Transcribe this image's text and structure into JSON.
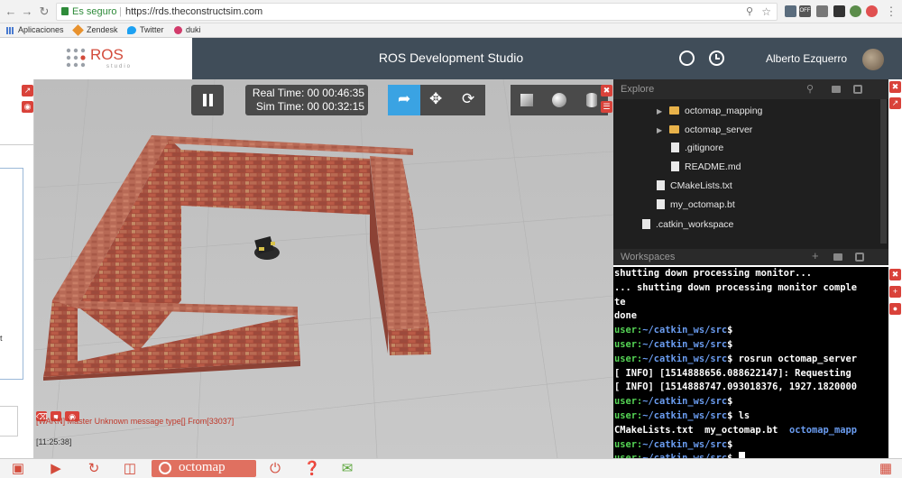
{
  "browser": {
    "secure_label": "Es seguro",
    "url": "https://rds.theconstructsim.com",
    "bookmarks": [
      {
        "label": "Aplicaciones",
        "icon": "apps-grid-icon"
      },
      {
        "label": "Zendesk",
        "icon": "zendesk-icon"
      },
      {
        "label": "Twitter",
        "icon": "twitter-icon"
      },
      {
        "label": "duki",
        "icon": "duki-icon"
      }
    ],
    "ext_badge": "OFF"
  },
  "header": {
    "logo_text": "ROS",
    "logo_subtext": "studio",
    "title": "ROS Development Studio",
    "user_name": "Alberto Ezquerro"
  },
  "sim": {
    "real_time": "Real Time: 00 00:46:35",
    "sim_time": "Sim Time: 00 00:32:15",
    "log_message": "[WARN] Master Unknown message type[] From[33037]",
    "log_time": "[11:25:38]"
  },
  "explore": {
    "title": "Explore",
    "items": [
      {
        "label": "octomap_mapping",
        "kind": "folder"
      },
      {
        "label": "octomap_server",
        "kind": "folder"
      },
      {
        "label": ".gitignore",
        "kind": "file"
      },
      {
        "label": "README.md",
        "kind": "file"
      },
      {
        "label": "CMakeLists.txt",
        "kind": "file"
      },
      {
        "label": "my_octomap.bt",
        "kind": "file"
      },
      {
        "label": ".catkin_workspace",
        "kind": "file"
      }
    ]
  },
  "workspaces": {
    "title": "Workspaces"
  },
  "terminal": {
    "lines": [
      "shutting down processing monitor...",
      "... shutting down processing monitor comple",
      "te",
      "done"
    ],
    "prompt_user": "user:",
    "prompt_path": "~/catkin_ws/src",
    "prompt_sign": "$",
    "cmd_rosrun": " rosrun octomap_server",
    "info1": "[ INFO] [1514888656.088622147]: Requesting",
    "info2": "[ INFO] [1514888747.093018376, 1927.1820000",
    "cmd_ls": " ls",
    "ls_plain": "CMakeLists.txt  my_octomap.bt  ",
    "ls_dir": "octomap_mapp"
  },
  "bottom": {
    "project_label": "octomap"
  },
  "colors": {
    "header_dark": "#404d59",
    "accent_red": "#d34b3b",
    "select_blue": "#3aa3e3",
    "prompt_green": "#55d455",
    "path_blue": "#6a9cf0"
  }
}
